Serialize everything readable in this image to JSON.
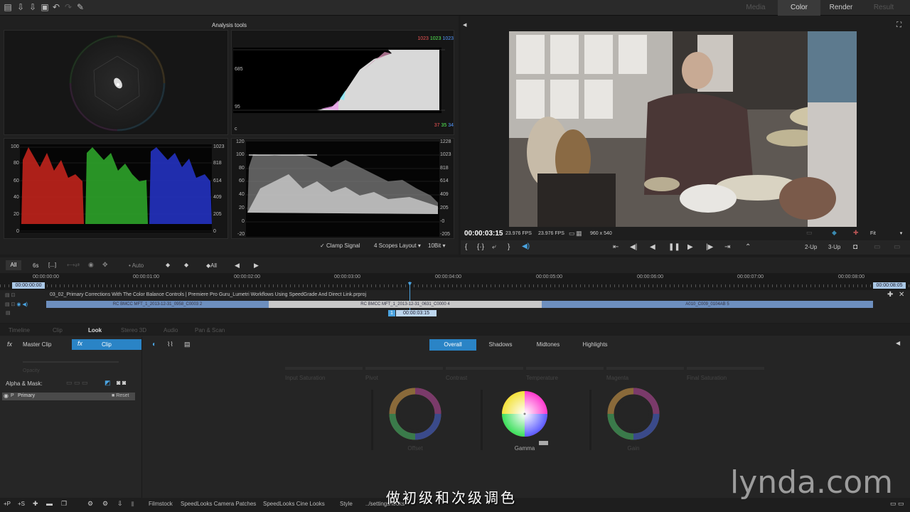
{
  "workspace_tabs": [
    {
      "label": "Media",
      "active": false
    },
    {
      "label": "Color",
      "active": true
    },
    {
      "label": "Render",
      "active": false
    },
    {
      "label": "Result",
      "active": false
    }
  ],
  "analysis": {
    "title": "Analysis tools",
    "histogram": {
      "readout_top": [
        "1023",
        "1023",
        "1023"
      ],
      "readout_bottom": [
        "37",
        "35",
        "34"
      ],
      "mark_high": "685",
      "mark_low": "95",
      "corner_label": "c"
    },
    "parade_ticks_left": [
      "100",
      "80",
      "60",
      "40",
      "20",
      "0"
    ],
    "parade_ticks_right": [
      "1023",
      "818",
      "614",
      "409",
      "205",
      "0"
    ],
    "waveform_ticks_left": [
      "120",
      "100",
      "80",
      "60",
      "40",
      "20",
      "0",
      "-20"
    ],
    "waveform_ticks_right": [
      "1228",
      "1023",
      "818",
      "614",
      "409",
      "205",
      "-0",
      "-205"
    ],
    "footer": {
      "clamp": "Clamp Signal",
      "layout": "4 Scopes Layout",
      "bits": "10Bit"
    }
  },
  "viewer": {
    "timecode": "00:00:03:15",
    "fps1": "23.976 FPS",
    "fps2": "23.976 FPS",
    "resolution": "960 x 540",
    "fit": "Fit",
    "up2": "2-Up",
    "up3": "3-Up"
  },
  "timeline": {
    "all_left": "All",
    "six_s": "6s",
    "auto": "Auto",
    "all_keys": "All",
    "ruler": [
      "00:00:00:00",
      "00:00:01:00",
      "00:00:02:00",
      "00:00:03:00",
      "00:00:04:00",
      "00:00:05:00",
      "00:00:06:00",
      "00:00:07:00",
      "00:00:08:00"
    ],
    "start_tc": "00:00:00:00",
    "end_tc": "00:00:08:05",
    "project": "03_02_Primary Corrections With The Color Balance Controls | Premiere Pro Guru_Lumetri Workflows Using SpeedGrade And Direct Link.prproj",
    "clips": [
      "RC BMCC MFT_1_2013-12-31_0958_C0003 2",
      "RC BMCC MFT_1_2013-12-31_0631_C0000 4",
      "A010_C009_0104AB 5"
    ],
    "playhead_num": "1",
    "playhead_tc": "00:00:03:15"
  },
  "look": {
    "tabs": [
      "Timeline",
      "Clip",
      "Look",
      "Stereo 3D",
      "Audio",
      "Pan & Scan"
    ],
    "active_tab": "Look",
    "master_clip": "Master Clip",
    "clip": "Clip",
    "opacity": "Opacity",
    "alpha_mask": "Alpha & Mask:",
    "layer_name": "Primary",
    "layer_reset": "Reset",
    "segments": [
      "Overall",
      "Shadows",
      "Midtones",
      "Highlights"
    ],
    "sliders": [
      "Input Saturation",
      "Pivot",
      "Contrast",
      "Temperature",
      "Magenta",
      "Final Saturation"
    ],
    "wheels": [
      "Offset",
      "Gamma",
      "Gain"
    ],
    "bottom": [
      "Filmstock",
      "SpeedLooks Camera Patches",
      "SpeedLooks Cine Looks",
      "Style",
      "../settings/looks"
    ]
  },
  "overlay": {
    "subtitle": "做初级和次级调色",
    "watermark": "lynda.com"
  },
  "colors": {
    "accent": "#2a84c6",
    "clip_blue": "#6d8fbf",
    "clip_light": "#c8c8c8"
  }
}
